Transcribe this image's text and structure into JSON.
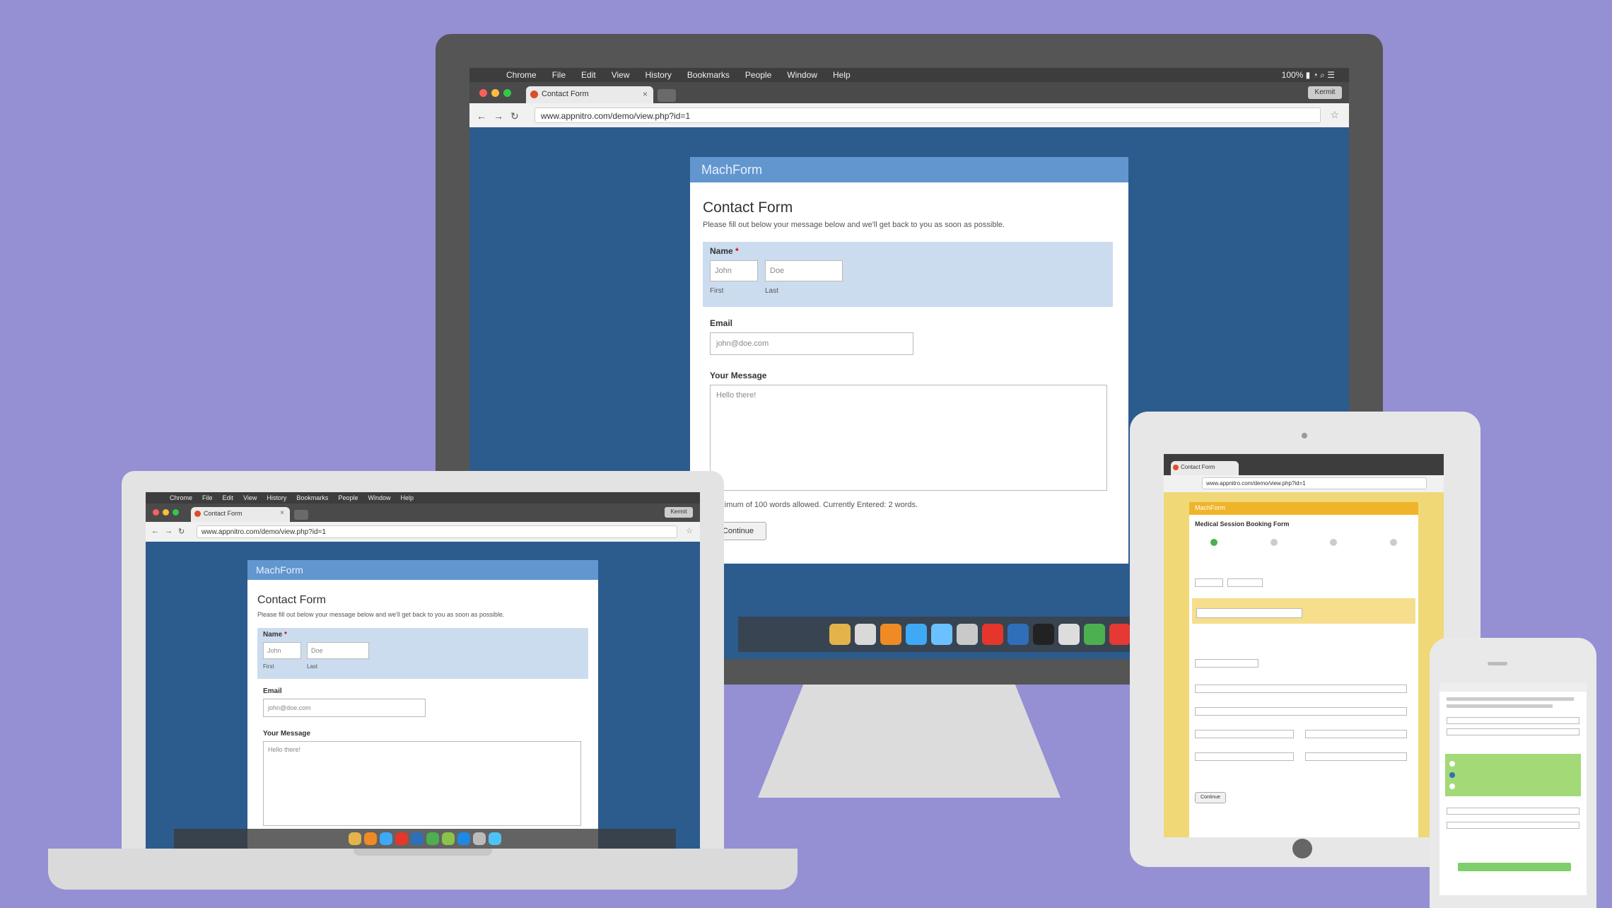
{
  "browser": {
    "menu": [
      "Chrome",
      "File",
      "Edit",
      "View",
      "History",
      "Bookmarks",
      "People",
      "Window",
      "Help"
    ],
    "tab_title": "Contact Form",
    "tab_close": "×",
    "url": "www.appnitro.com/demo/view.php?id=1",
    "profile": "Kermit",
    "back": "←",
    "forward": "→",
    "reload": "↻",
    "star": "☆",
    "apple": "",
    "status": "100% ▮ ◔ ⌕ ☰"
  },
  "form": {
    "header": "MachForm",
    "title": "Contact Form",
    "description": "Please fill out below your message below and we'll get back to you as soon as possible.",
    "name_label": "Name",
    "required_mark": "*",
    "first_value": "John",
    "last_value": "Doe",
    "first_sub": "First",
    "last_sub": "Last",
    "email_label": "Email",
    "email_value": "john@doe.com",
    "message_label": "Your Message",
    "message_value": "Hello there!",
    "char_note": "Maximum of 100 words allowed.  Currently Entered: 2 words.",
    "continue": "Continue"
  },
  "tablet": {
    "header": "MachForm",
    "title": "Medical Session Booking Form",
    "continue": "Continue"
  },
  "colors": {
    "background": "#9490d3",
    "form_header": "#6196cf",
    "page_blue": "#2c5b8e",
    "name_highlight": "#ccdcef",
    "tablet_yellow": "#f1d877",
    "phone_green": "#a3d977"
  }
}
